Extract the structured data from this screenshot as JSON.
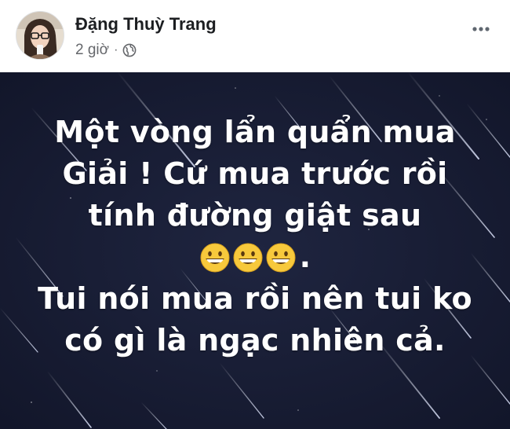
{
  "post": {
    "author_name": "Đặng Thuỳ Trang",
    "time": "2 giờ",
    "separator": "·",
    "privacy_icon": "globe-icon",
    "more_icon": "more-horizontal-icon"
  },
  "card": {
    "background_color": "#161a2b",
    "text_color": "#ffffff",
    "lines": [
      "Một vòng lẩn quẩn mua",
      "Giải ! Cứ mua trước rồi",
      "tính đường giật sau"
    ],
    "emoji_line": {
      "emoji": [
        "grinning-face-emoji",
        "grinning-face-emoji",
        "grinning-face-emoji"
      ],
      "trailing": "."
    },
    "lines_after": [
      "Tui nói mua rồi nên tui ko",
      "có gì là ngạc nhiên cả."
    ]
  }
}
